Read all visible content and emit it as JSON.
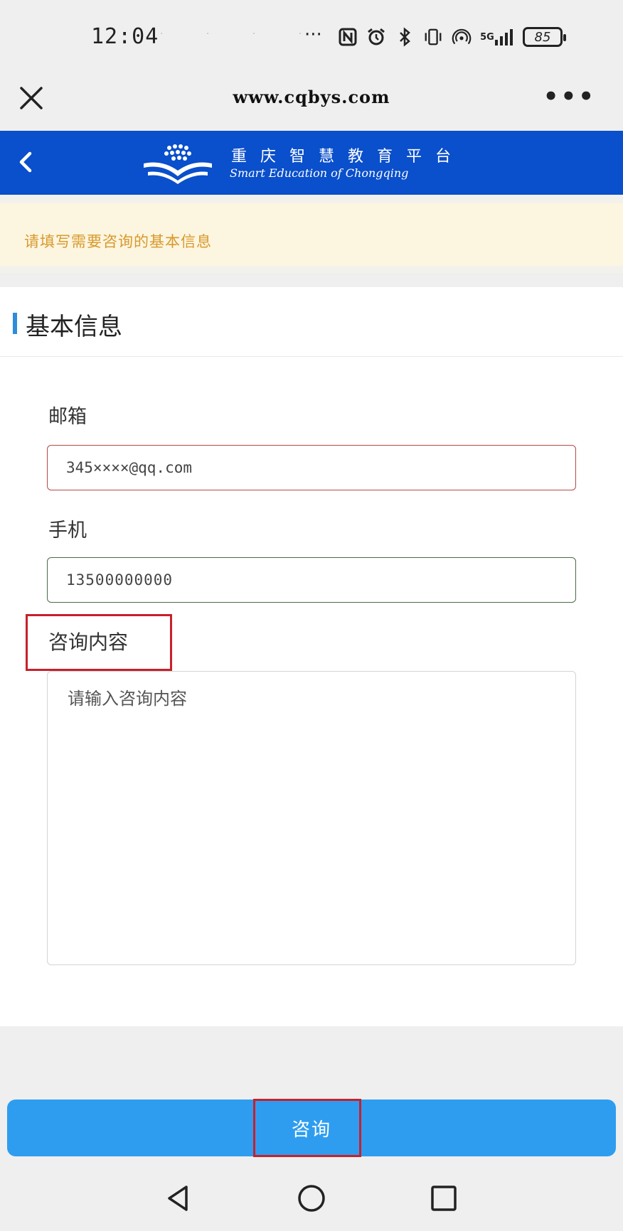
{
  "status_bar": {
    "time": "12:04",
    "dots": "· · · · ·",
    "more": "···",
    "signal_label": "5G",
    "battery": "85"
  },
  "browser": {
    "url": "www.cqbys.com"
  },
  "header": {
    "brand_cn": "重庆智慧教育平台",
    "brand_en": "Smart Education of Chongqing"
  },
  "notice": {
    "text": "请填写需要咨询的基本信息"
  },
  "section": {
    "title": "基本信息"
  },
  "form": {
    "email_label": "邮箱",
    "email_value": "345××××@qq.com",
    "phone_label": "手机",
    "phone_value": "13500000000",
    "content_label": "咨询内容",
    "content_placeholder": "请输入咨询内容"
  },
  "actions": {
    "submit_label": "咨询"
  },
  "colors": {
    "header_blue": "#0a4fcb",
    "button_blue": "#2e9df0",
    "notice_text": "#d89a2c",
    "highlight_red": "#c8202a"
  }
}
